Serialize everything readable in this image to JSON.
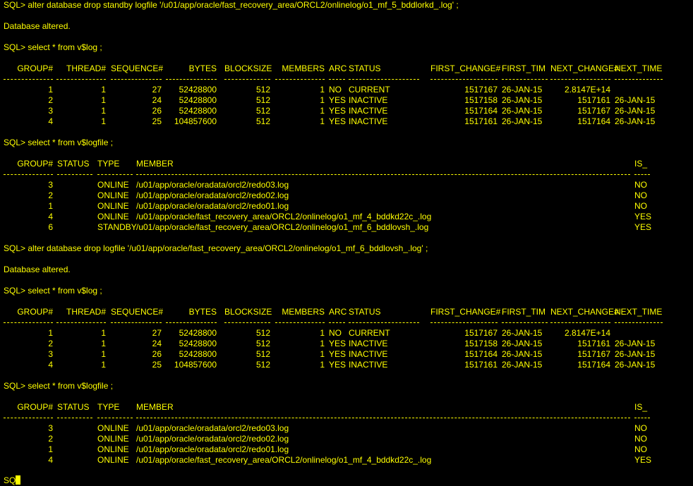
{
  "colors": {
    "background": "#000000",
    "foreground": "#ffff00"
  },
  "commands": [
    "SQL> alter database drop standby logfile '/u01/app/oracle/fast_recovery_area/ORCL2/onlinelog/o1_mf_5_bddlorkd_.log' ;",
    "Database altered.",
    "SQL> select * from v$log ;",
    "SQL> select * from v$logfile ;",
    "SQL> alter database drop logfile '/u01/app/oracle/fast_recovery_area/ORCL2/onlinelog/o1_mf_6_bddlovsh_.log' ;",
    "Database altered.",
    "SQL> select * from v$log ;",
    "SQL> select * from v$logfile ;",
    "SQ"
  ],
  "vlog_headers": [
    "GROUP#",
    "THREAD#",
    "SEQUENCE#",
    "BYTES",
    "BLOCKSIZE",
    "MEMBERS",
    "ARC",
    "STATUS",
    "FIRST_CHANGE#",
    "FIRST_TIM",
    "NEXT_CHANGE#",
    "NEXT_TIME"
  ],
  "vlogfile_headers": [
    "GROUP#",
    "STATUS",
    "TYPE",
    "MEMBER",
    "IS_"
  ],
  "vlog_1": [
    [
      "1",
      "1",
      "27",
      "52428800",
      "512",
      "1",
      "NO",
      "CURRENT",
      "1517167",
      "26-JAN-15",
      "2.8147E+14",
      ""
    ],
    [
      "2",
      "1",
      "24",
      "52428800",
      "512",
      "1",
      "YES",
      "INACTIVE",
      "1517158",
      "26-JAN-15",
      "1517161",
      "26-JAN-15"
    ],
    [
      "3",
      "1",
      "26",
      "52428800",
      "512",
      "1",
      "YES",
      "INACTIVE",
      "1517164",
      "26-JAN-15",
      "1517167",
      "26-JAN-15"
    ],
    [
      "4",
      "1",
      "25",
      "104857600",
      "512",
      "1",
      "YES",
      "INACTIVE",
      "1517161",
      "26-JAN-15",
      "1517164",
      "26-JAN-15"
    ]
  ],
  "vlogfile_1": [
    [
      "3",
      "",
      "ONLINE",
      "/u01/app/oracle/oradata/orcl2/redo03.log",
      "NO"
    ],
    [
      "2",
      "",
      "ONLINE",
      "/u01/app/oracle/oradata/orcl2/redo02.log",
      "NO"
    ],
    [
      "1",
      "",
      "ONLINE",
      "/u01/app/oracle/oradata/orcl2/redo01.log",
      "NO"
    ],
    [
      "4",
      "",
      "ONLINE",
      "/u01/app/oracle/fast_recovery_area/ORCL2/onlinelog/o1_mf_4_bddkd22c_.log",
      "YES"
    ],
    [
      "6",
      "",
      "STANDBY",
      "/u01/app/oracle/fast_recovery_area/ORCL2/onlinelog/o1_mf_6_bddlovsh_.log",
      "YES"
    ]
  ],
  "vlog_2": [
    [
      "1",
      "1",
      "27",
      "52428800",
      "512",
      "1",
      "NO",
      "CURRENT",
      "1517167",
      "26-JAN-15",
      "2.8147E+14",
      ""
    ],
    [
      "2",
      "1",
      "24",
      "52428800",
      "512",
      "1",
      "YES",
      "INACTIVE",
      "1517158",
      "26-JAN-15",
      "1517161",
      "26-JAN-15"
    ],
    [
      "3",
      "1",
      "26",
      "52428800",
      "512",
      "1",
      "YES",
      "INACTIVE",
      "1517164",
      "26-JAN-15",
      "1517167",
      "26-JAN-15"
    ],
    [
      "4",
      "1",
      "25",
      "104857600",
      "512",
      "1",
      "YES",
      "INACTIVE",
      "1517161",
      "26-JAN-15",
      "1517164",
      "26-JAN-15"
    ]
  ],
  "vlogfile_2": [
    [
      "3",
      "",
      "ONLINE",
      "/u01/app/oracle/oradata/orcl2/redo03.log",
      "NO"
    ],
    [
      "2",
      "",
      "ONLINE",
      "/u01/app/oracle/oradata/orcl2/redo02.log",
      "NO"
    ],
    [
      "1",
      "",
      "ONLINE",
      "/u01/app/oracle/oradata/orcl2/redo01.log",
      "NO"
    ],
    [
      "4",
      "",
      "ONLINE",
      "/u01/app/oracle/fast_recovery_area/ORCL2/onlinelog/o1_mf_4_bddkd22c_.log",
      "YES"
    ]
  ]
}
